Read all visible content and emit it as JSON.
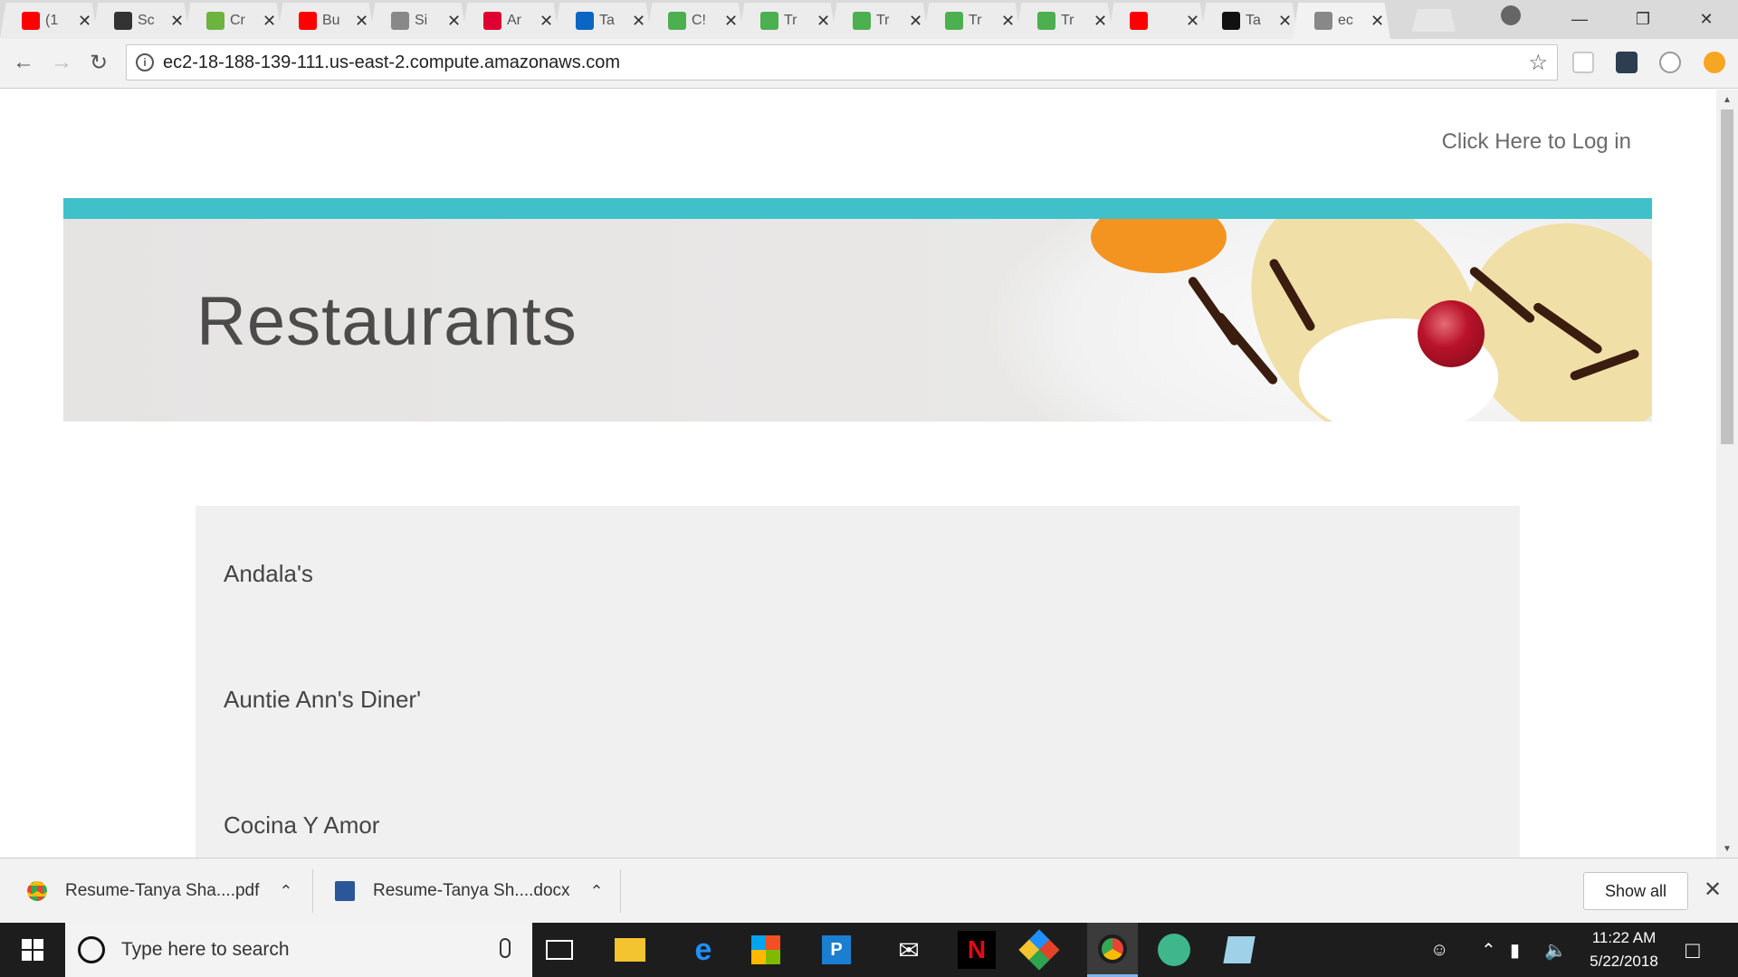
{
  "browser": {
    "tabs": [
      {
        "title": "(1",
        "icon": "youtube-icon",
        "color": "#ff0000"
      },
      {
        "title": "Sc",
        "icon": "grid-icon",
        "color": "#333333"
      },
      {
        "title": "Cr",
        "icon": "leaf-icon",
        "color": "#6db33f"
      },
      {
        "title": "Bu",
        "icon": "youtube-icon",
        "color": "#ff0000"
      },
      {
        "title": "Si",
        "icon": "page-icon",
        "color": "#888888"
      },
      {
        "title": "Ar",
        "icon": "angular-icon",
        "color": "#dd0031"
      },
      {
        "title": "Ta",
        "icon": "linkedin-icon",
        "color": "#0a66c2"
      },
      {
        "title": "C!",
        "icon": "w3schools-icon",
        "color": "#4caf50"
      },
      {
        "title": "Tr",
        "icon": "w3schools-icon",
        "color": "#4caf50"
      },
      {
        "title": "Tr",
        "icon": "w3schools-icon",
        "color": "#4caf50"
      },
      {
        "title": "Tr",
        "icon": "w3schools-icon",
        "color": "#4caf50"
      },
      {
        "title": "Tr",
        "icon": "w3schools-icon",
        "color": "#4caf50"
      },
      {
        "title": "",
        "icon": "youtube-icon",
        "color": "#ff0000"
      },
      {
        "title": "Ta",
        "icon": "github-icon",
        "color": "#111111"
      },
      {
        "title": "ec",
        "icon": "page-icon",
        "color": "#888888",
        "active": true
      }
    ],
    "url": "ec2-18-188-139-111.us-east-2.compute.amazonaws.com"
  },
  "page": {
    "login_link": "Click Here to Log in",
    "hero_title": "Restaurants",
    "accent_color": "#40c1c9",
    "restaurants": [
      "Andala's",
      "Auntie Ann's Diner'",
      "Cocina Y Amor"
    ]
  },
  "downloads": {
    "items": [
      {
        "name": "Resume-Tanya Sha....pdf",
        "icon": "chrome-icon"
      },
      {
        "name": "Resume-Tanya Sh....docx",
        "icon": "word-icon"
      }
    ],
    "show_all": "Show all"
  },
  "taskbar": {
    "search_placeholder": "Type here to search",
    "time": "11:22 AM",
    "date": "5/22/2018"
  }
}
